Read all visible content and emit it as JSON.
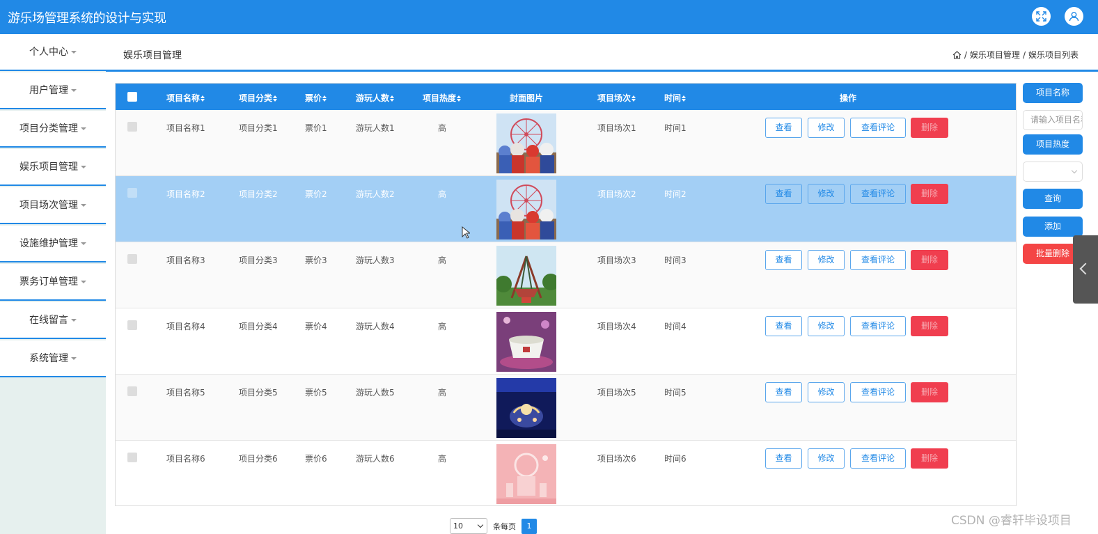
{
  "app": {
    "title": "游乐场管理系统的设计与实现"
  },
  "sidebar": {
    "items": [
      {
        "label": "个人中心"
      },
      {
        "label": "用户管理"
      },
      {
        "label": "项目分类管理"
      },
      {
        "label": "娱乐项目管理"
      },
      {
        "label": "项目场次管理"
      },
      {
        "label": "设施维护管理"
      },
      {
        "label": "票务订单管理"
      },
      {
        "label": "在线留言"
      },
      {
        "label": "系统管理"
      }
    ]
  },
  "header": {
    "page_title": "娱乐项目管理",
    "breadcrumb": [
      "娱乐项目管理",
      "娱乐项目列表"
    ],
    "breadcrumb_sep": "/"
  },
  "table": {
    "columns": [
      "项目名称",
      "项目分类",
      "票价",
      "游玩人数",
      "项目热度",
      "封面图片",
      "项目场次",
      "时间",
      "操作"
    ],
    "actions": {
      "view": "查看",
      "edit": "修改",
      "comments": "查看评论",
      "delete": "删除"
    },
    "rows": [
      {
        "name": "项目名称1",
        "category": "项目分类1",
        "price": "票价1",
        "players": "游玩人数1",
        "heat": "高",
        "session": "项目场次1",
        "time": "时间1",
        "image": "ferris-wheel-mascots"
      },
      {
        "name": "项目名称2",
        "category": "项目分类2",
        "price": "票价2",
        "players": "游玩人数2",
        "heat": "高",
        "session": "项目场次2",
        "time": "时间2",
        "image": "ferris-wheel-mascots"
      },
      {
        "name": "项目名称3",
        "category": "项目分类3",
        "price": "票价3",
        "players": "游玩人数3",
        "heat": "高",
        "session": "项目场次3",
        "time": "时间3",
        "image": "pirate-ship-ride"
      },
      {
        "name": "项目名称4",
        "category": "项目分类4",
        "price": "票价4",
        "players": "游玩人数4",
        "heat": "高",
        "session": "项目场次4",
        "time": "时间4",
        "image": "teacup-ride"
      },
      {
        "name": "项目名称5",
        "category": "项目分类5",
        "price": "票价5",
        "players": "游玩人数5",
        "heat": "高",
        "session": "项目场次5",
        "time": "时间5",
        "image": "carousel-night"
      },
      {
        "name": "项目名称6",
        "category": "项目分类6",
        "price": "票价6",
        "players": "游玩人数6",
        "heat": "高",
        "session": "项目场次6",
        "time": "时间6",
        "image": "pink-castle"
      }
    ]
  },
  "search_panel": {
    "name_label": "项目名称",
    "name_placeholder": "请输入项目名称",
    "heat_label": "项目热度",
    "query": "查询",
    "add": "添加",
    "batch_delete": "批量删除"
  },
  "pagination": {
    "page_size": "10",
    "per_page_label": "条每页",
    "current_page": "1"
  },
  "watermark": "CSDN @睿轩毕设项目",
  "colors": {
    "primary": "#2189e6",
    "danger": "#f03e4f",
    "selected_row": "#a3cff5"
  }
}
